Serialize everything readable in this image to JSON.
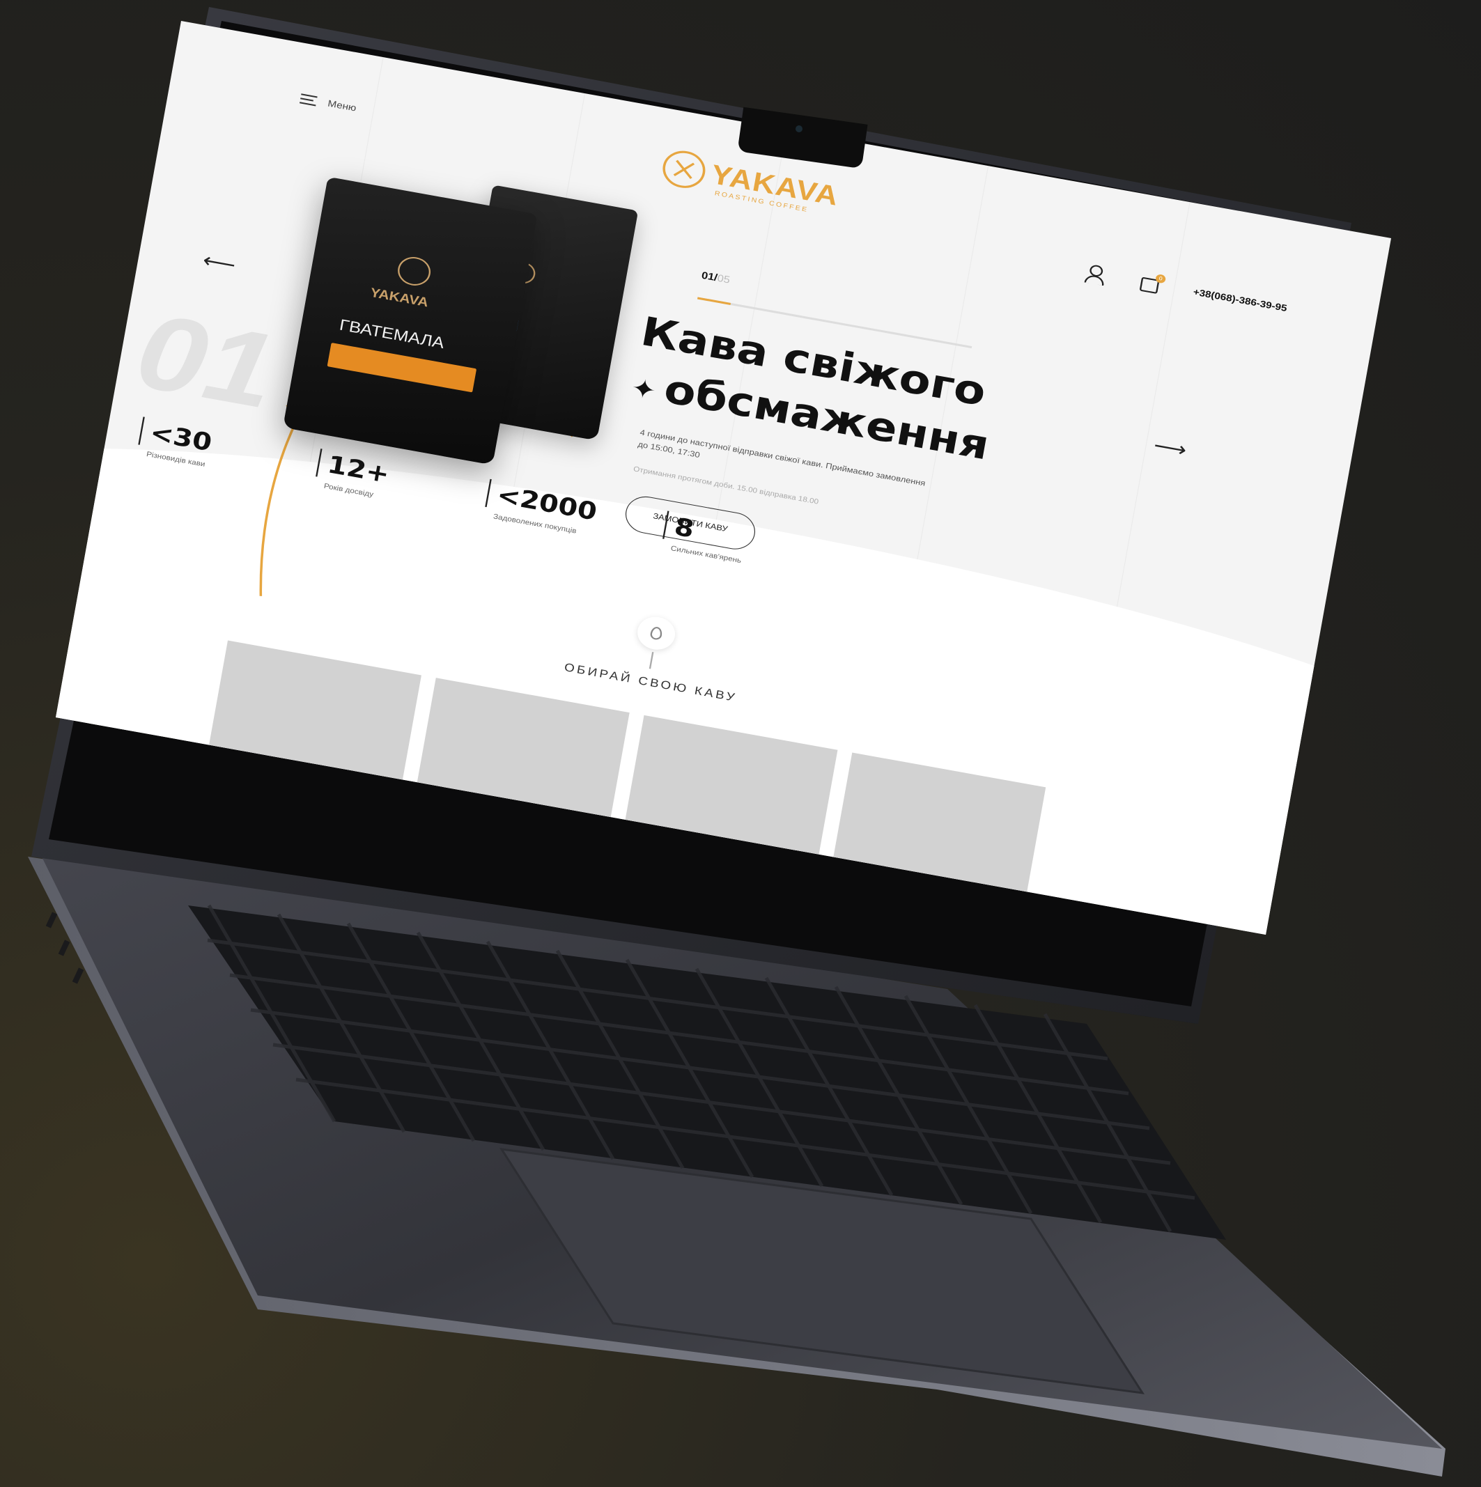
{
  "site": {
    "menu_label": "Меню",
    "logo": {
      "name": "YAKAVA",
      "tagline": "ROASTING COFFEE"
    },
    "phone": "+38(068)-386-39-95",
    "cart_count": "0"
  },
  "slider": {
    "current": "01/",
    "total": "05",
    "progress_fraction": 0.12,
    "big_number": "01"
  },
  "hero": {
    "title_line1": "Кава свіжого",
    "title_line2": "обсмаження",
    "description": "4 години до наступної відправки свіжої кави. Приймаємо замовлення до 15:00, 17:30",
    "note": "Отримання протягом доби. 15.00 відправка 18.00",
    "cta_label": "ЗАМОВИТИ КАВУ"
  },
  "product": {
    "brand": "YAKAVA",
    "front_bag_title": "ГВАТЕМАЛА"
  },
  "stats": [
    {
      "value": "<30",
      "label": "Різновидів кави"
    },
    {
      "value": "12+",
      "label": "Років досвіду"
    },
    {
      "value": "<2000",
      "label": "Задоволених покупців"
    },
    {
      "value": "8",
      "label": "Сильних кав'ярень"
    }
  ],
  "section": {
    "title": "ОБИРАЙ СВОЮ КАВУ"
  },
  "colors": {
    "accent": "#e7a640",
    "background": "#1d1d1c",
    "screen_bg": "#f4f4f4",
    "laptop_body": "#2b2c31",
    "keyboard_key": "#0f0f10"
  }
}
